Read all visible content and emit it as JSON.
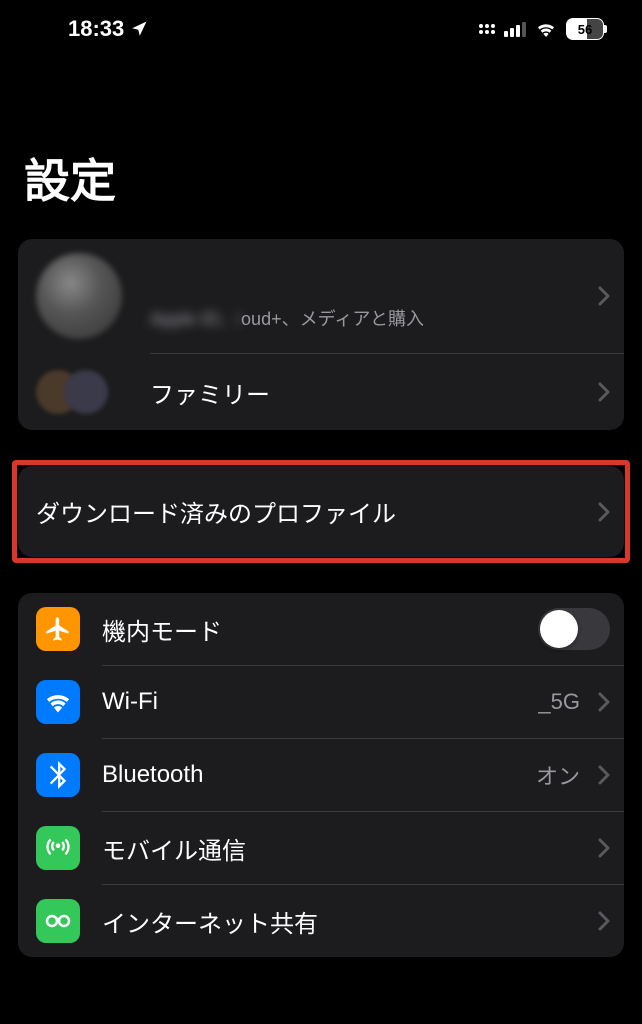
{
  "status": {
    "time": "18:33",
    "battery": "56"
  },
  "page": {
    "title": "設定"
  },
  "account": {
    "name": "　　　　",
    "subtitle_blur": "Apple ID、i",
    "subtitle_suffix": "oud+、メディアと購入"
  },
  "family": {
    "label": "ファミリー"
  },
  "profile": {
    "label": "ダウンロード済みのプロファイル"
  },
  "connectivity": {
    "airplane": "機内モード",
    "wifi_label": "Wi-Fi",
    "wifi_value_blur": "　　　　　　　",
    "wifi_value_suffix": "_5G",
    "bluetooth_label": "Bluetooth",
    "bluetooth_value": "オン",
    "cellular": "モバイル通信",
    "hotspot": "インターネット共有"
  }
}
